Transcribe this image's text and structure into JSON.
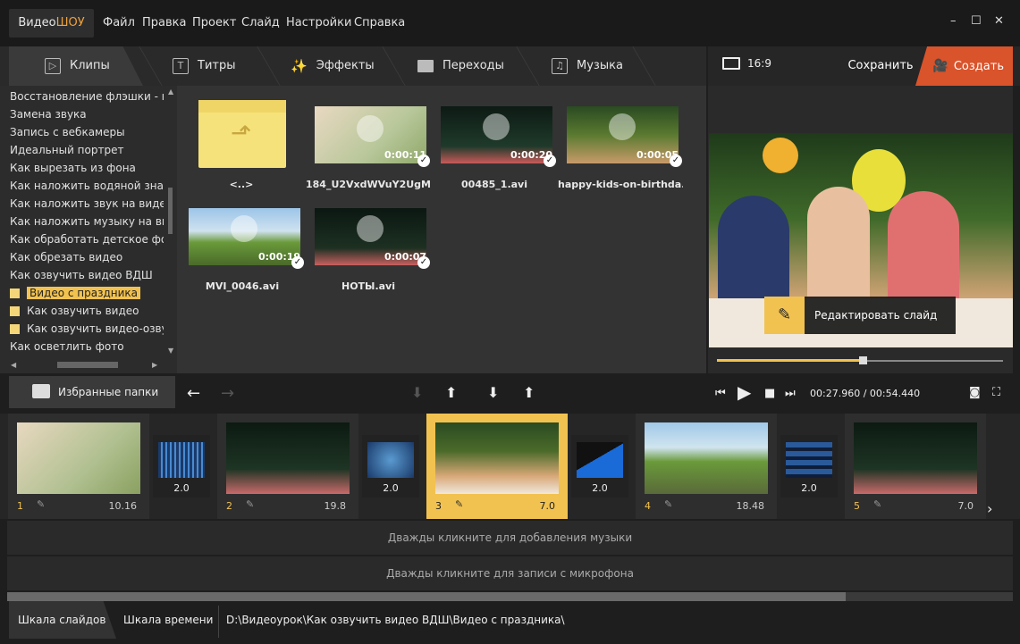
{
  "app": {
    "logo_part1": "Видео",
    "logo_part2": "ШОУ"
  },
  "menu": [
    "Файл",
    "Правка",
    "Проект",
    "Слайд",
    "Настройки",
    "Справка"
  ],
  "window_controls": [
    "–",
    "☐",
    "✕"
  ],
  "tabs": [
    {
      "label": "Клипы",
      "icon": "play-box-icon"
    },
    {
      "label": "Титры",
      "icon": "text-icon"
    },
    {
      "label": "Эффекты",
      "icon": "magic-wand-icon"
    },
    {
      "label": "Переходы",
      "icon": "clapper-icon"
    },
    {
      "label": "Музыка",
      "icon": "music-icon"
    }
  ],
  "header_right": {
    "aspect": "16:9",
    "save": "Сохранить",
    "create": "Создать"
  },
  "tree": {
    "items": [
      "Восстановление флэшки - но",
      "Замена звука",
      "Запись с вебкамеры",
      "Идеальный портрет",
      "Как вырезать из фона",
      "Как наложить водяной знак",
      "Как наложить звук на видео",
      "Как наложить музыку на вид",
      "Как обработать детское фото",
      "Как обрезать видео",
      "Как озвучить видео ВДШ"
    ],
    "folders": [
      "Видео с праздника",
      "Как озвучить видео",
      "Как озвучить видео-озвуч"
    ],
    "tail": [
      "Как осветлить фото"
    ]
  },
  "clips": [
    {
      "name": "<..>",
      "duration": ""
    },
    {
      "name": "184_U2VxdWVuY2UgM...",
      "duration": "0:00:11"
    },
    {
      "name": "00485_1.avi",
      "duration": "0:00:20"
    },
    {
      "name": "happy-kids-on-birthda...",
      "duration": "0:00:05"
    },
    {
      "name": "MVI_0046.avi",
      "duration": "0:00:19"
    },
    {
      "name": "НОТЫ.avi",
      "duration": "0:00:07"
    }
  ],
  "preview": {
    "edit_label": "Редактировать слайд",
    "progress": 0.51
  },
  "toolbar": {
    "favorites": "Избранные папки",
    "time_current": "00:27.960",
    "time_sep": " / ",
    "time_total": "00:54.440"
  },
  "timeline": {
    "slides": [
      {
        "num": "1",
        "dur": "10.16"
      },
      {
        "num": "2",
        "dur": "19.8"
      },
      {
        "num": "3",
        "dur": "7.0"
      },
      {
        "num": "4",
        "dur": "18.48"
      },
      {
        "num": "5",
        "dur": "7.0"
      }
    ],
    "transitions": [
      "2.0",
      "2.0",
      "2.0",
      "2.0"
    ],
    "music_hint": "Дважды кликните для добавления музыки",
    "mic_hint": "Дважды кликните для записи с микрофона"
  },
  "bottom": {
    "slides_tab": "Шкала слайдов",
    "time_tab": "Шкала времени",
    "path": "D:\\Видеоурок\\Как озвучить видео ВДШ\\Видео с праздника\\"
  },
  "colors": {
    "accent": "#f2c250",
    "create": "#d9532b"
  }
}
